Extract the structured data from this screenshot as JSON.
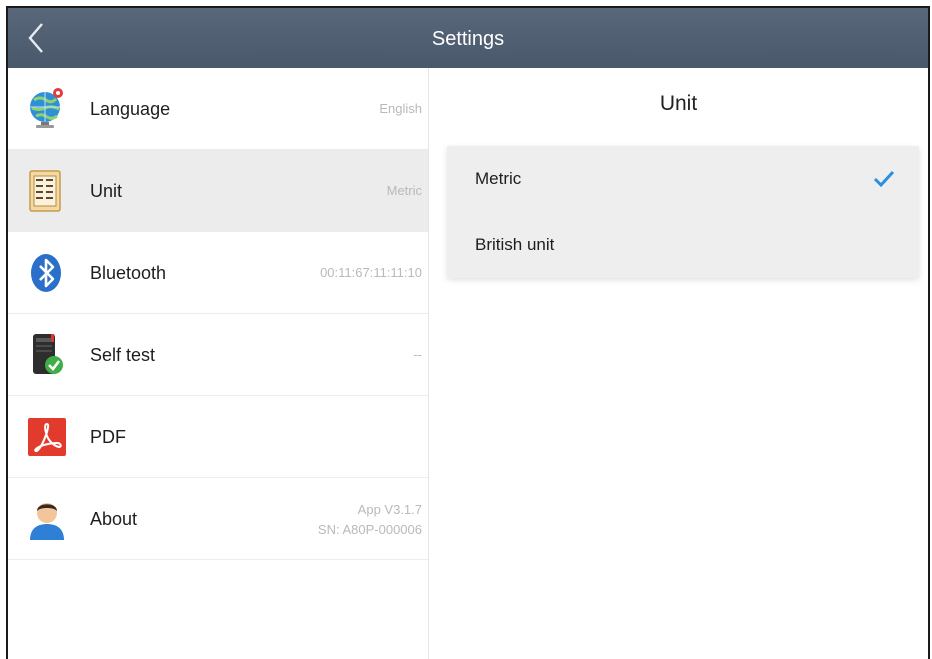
{
  "header": {
    "title": "Settings",
    "back_icon": "chevron-left-icon"
  },
  "sidebar": {
    "items": [
      {
        "label": "Language",
        "value": "English",
        "icon": "globe-icon"
      },
      {
        "label": "Unit",
        "value": "Metric",
        "icon": "unit-table-icon",
        "selected": true
      },
      {
        "label": "Bluetooth",
        "value": "00:11:67:11:11:10",
        "icon": "bluetooth-icon"
      },
      {
        "label": "Self test",
        "value": "--",
        "icon": "device-check-icon"
      },
      {
        "label": "PDF",
        "value": "",
        "icon": "pdf-icon"
      },
      {
        "label": "About",
        "value_line1": "App V3.1.7",
        "value_line2": "SN: A80P-000006",
        "icon": "user-icon"
      }
    ]
  },
  "unit_panel": {
    "title": "Unit",
    "options": [
      {
        "label": "Metric",
        "checked": true
      },
      {
        "label": "British unit",
        "checked": false
      }
    ]
  },
  "colors": {
    "header_bg": "#4f5d71",
    "check": "#2b8fe0",
    "selected_row": "#ececec"
  }
}
